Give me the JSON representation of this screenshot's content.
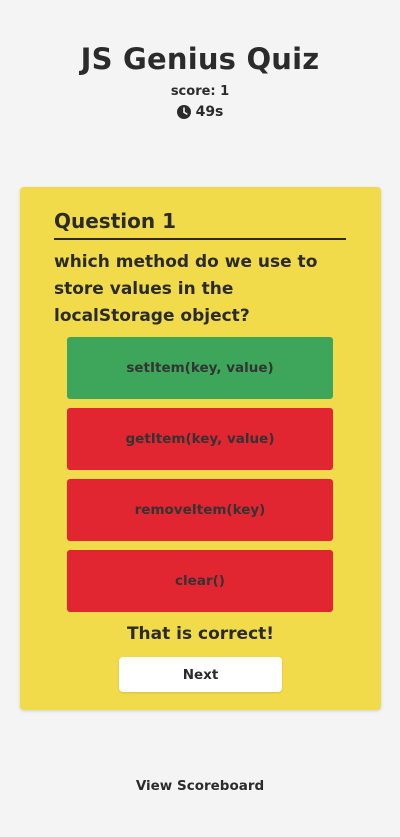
{
  "header": {
    "title": "JS Genius Quiz",
    "score_text": "score: 1",
    "timer_text": "49s",
    "timer_icon": "clock-icon"
  },
  "question": {
    "heading": "Question 1",
    "text": "which method do we use to store values in the localStorage object?",
    "answers": [
      {
        "label": "setItem(key, value)",
        "state": "correct"
      },
      {
        "label": "getItem(key, value)",
        "state": "wrong"
      },
      {
        "label": "removeItem(key)",
        "state": "wrong"
      },
      {
        "label": "clear()",
        "state": "wrong"
      }
    ],
    "feedback": "That is correct!",
    "next_label": "Next"
  },
  "footer": {
    "scoreboard_label": "View Scoreboard"
  },
  "colors": {
    "background": "#f4f4f4",
    "card": "#f1db4b",
    "correct": "#3ea65b",
    "wrong": "#e12631",
    "text": "#2b2b2b"
  }
}
